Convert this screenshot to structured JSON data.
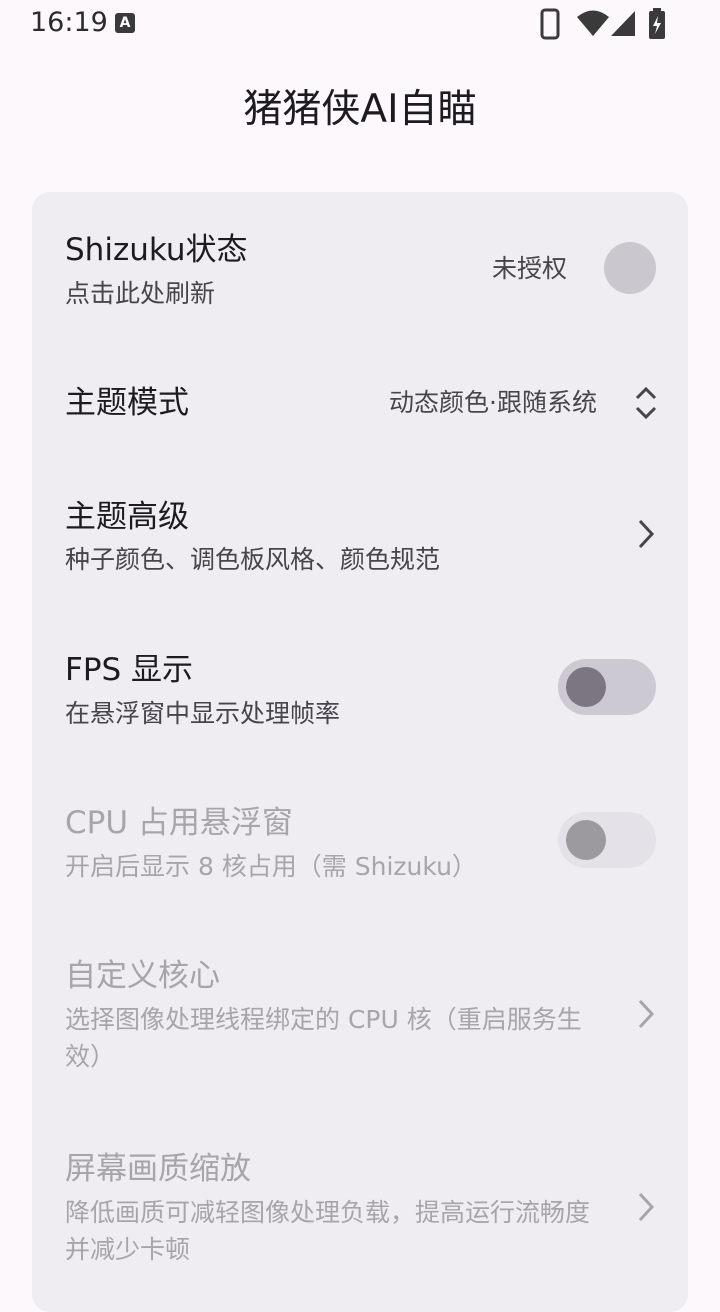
{
  "status_bar": {
    "time": "16:19",
    "notification_icon": "a-icon",
    "icons": [
      "phone-icon",
      "wifi-icon",
      "signal-icon",
      "battery-charging-icon"
    ]
  },
  "app": {
    "title": "猪猪侠AI自瞄"
  },
  "settings": {
    "shizuku": {
      "title": "Shizuku状态",
      "subtitle": "点击此处刷新",
      "status": "未授权"
    },
    "theme_mode": {
      "title": "主题模式",
      "value": "动态颜色·跟随系统"
    },
    "theme_advanced": {
      "title": "主题高级",
      "subtitle": "种子颜色、调色板风格、颜色规范"
    },
    "fps": {
      "title": "FPS 显示",
      "subtitle": "在悬浮窗中显示处理帧率",
      "enabled": false
    },
    "cpu_overlay": {
      "title": "CPU 占用悬浮窗",
      "subtitle": "开启后显示 8 核占用（需 Shizuku）",
      "enabled": false
    },
    "custom_core": {
      "title": "自定义核心",
      "subtitle": "选择图像处理线程绑定的 CPU 核（重启服务生效）"
    },
    "screen_scale": {
      "title": "屏幕画质缩放",
      "subtitle": "降低画质可减轻图像处理负载，提高运行流畅度并减少卡顿"
    }
  },
  "colors": {
    "background": "#fcf8fc",
    "card": "#efedf2",
    "disabled_text": "#a7a5ab"
  }
}
